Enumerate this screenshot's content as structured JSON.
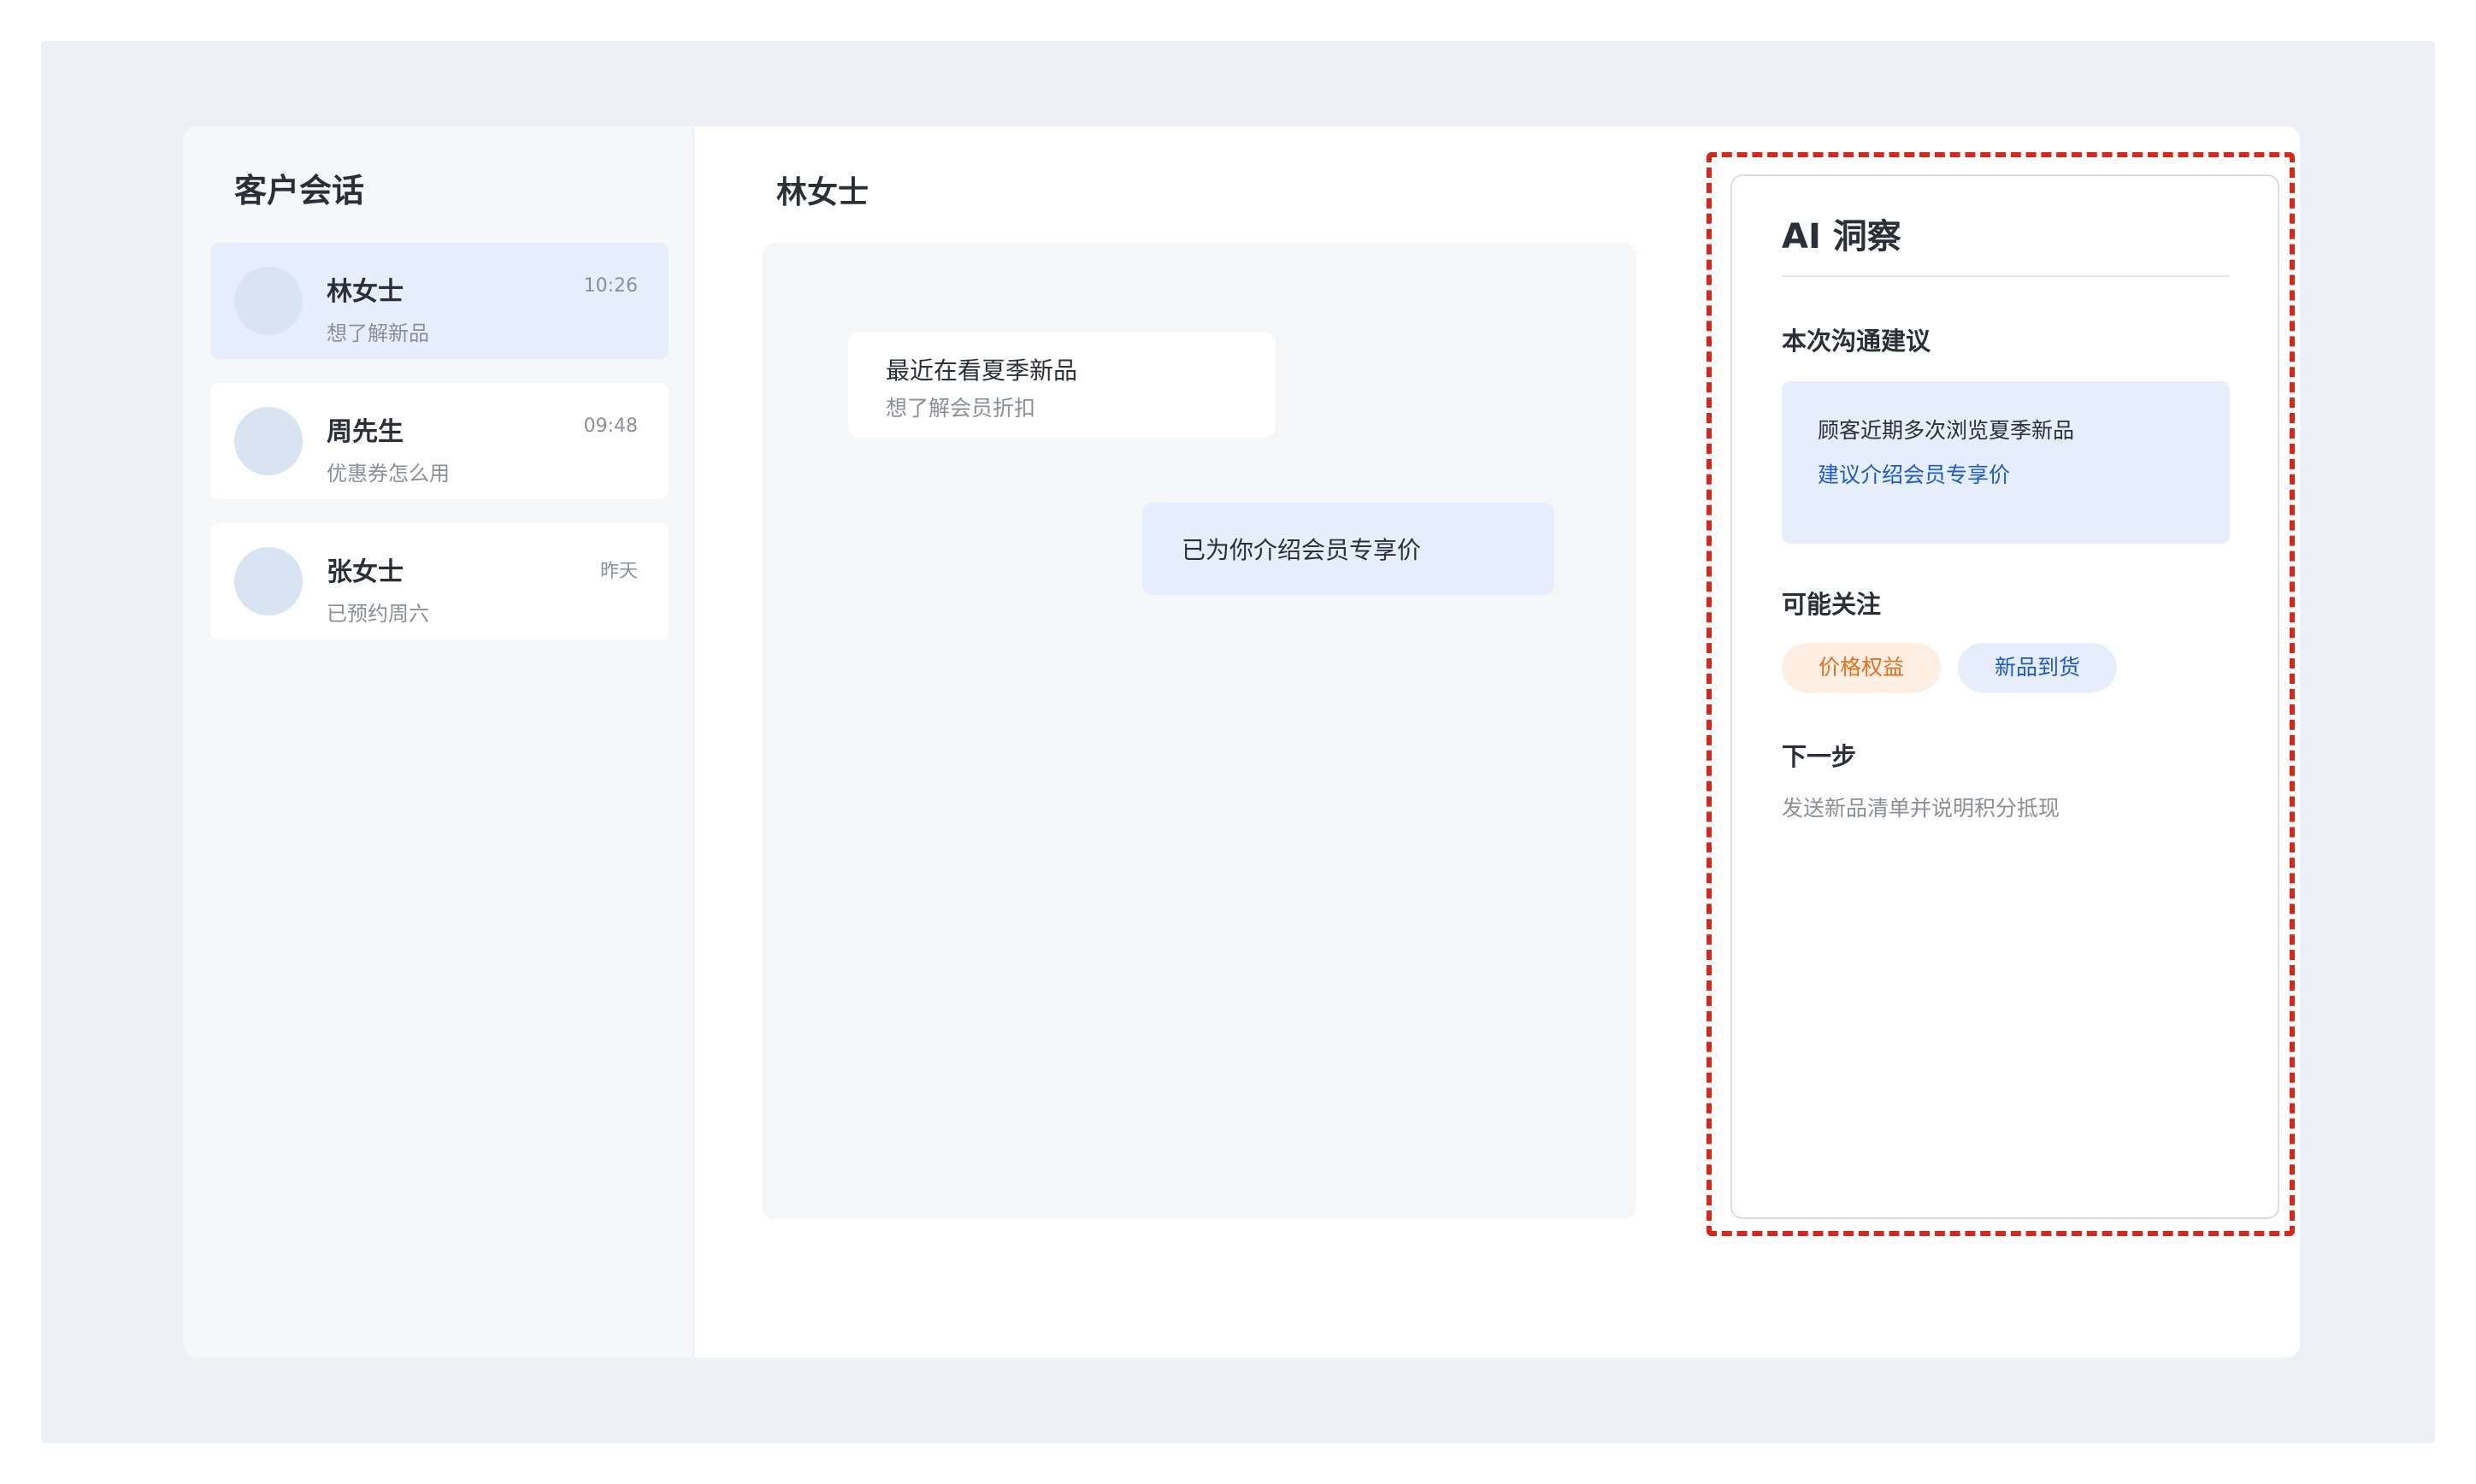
{
  "sidebar": {
    "title": "客户会话",
    "conversations": [
      {
        "name": "林女士",
        "time": "10:26",
        "preview": "想了解新品",
        "active": true
      },
      {
        "name": "周先生",
        "time": "09:48",
        "preview": "优惠券怎么用",
        "active": false
      },
      {
        "name": "张女士",
        "time": "昨天",
        "preview": "已预约周六",
        "active": false
      }
    ]
  },
  "chat": {
    "title": "林女士",
    "messages": [
      {
        "direction": "incoming",
        "text": "最近在看夏季新品",
        "subtext": "想了解会员折扣"
      },
      {
        "direction": "outgoing",
        "text": "已为你介绍会员专享价"
      }
    ]
  },
  "insight": {
    "title": "AI 洞察",
    "suggestion_heading": "本次沟通建议",
    "suggestion_text": "顾客近期多次浏览夏季新品",
    "suggestion_link": "建议介绍会员专享价",
    "focus_heading": "可能关注",
    "tags": [
      {
        "label": "价格权益",
        "color": "#e4701e"
      },
      {
        "label": "新品到货",
        "color": "#1f5bc6"
      }
    ],
    "next_heading": "下一步",
    "next_text": "发送新品清单并说明积分抵现"
  },
  "colors": {
    "accent": "#1f5bc6",
    "active_bg": "#e6eefc",
    "highlight_border": "#d3281c",
    "warm_tag": "#e4701e"
  }
}
